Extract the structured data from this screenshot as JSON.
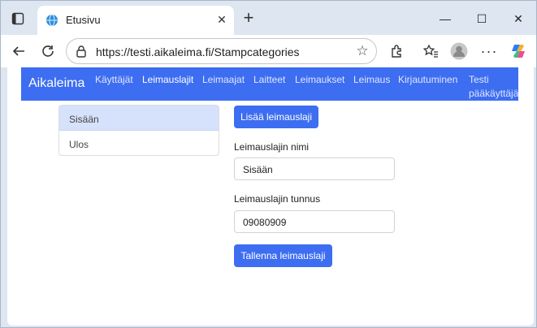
{
  "browser": {
    "tab_title": "Etusivu",
    "tab_close_glyph": "✕",
    "new_tab_glyph": "+",
    "url": "https://testi.aikaleima.fi/Stampcategories",
    "window_controls": {
      "minimize": "—",
      "maximize": "☐",
      "close": "✕"
    },
    "icons": [
      "window-icon",
      "globe-icon",
      "back-arrow-icon",
      "reload-icon",
      "lock-icon",
      "star-icon",
      "extensions-icon",
      "favorites-icon",
      "profile-avatar-icon",
      "more-icon",
      "copilot-icon"
    ]
  },
  "navbar": {
    "brand": "Aikaleima",
    "links": [
      {
        "label": "Käyttäjät"
      },
      {
        "label": "Leimauslajit"
      },
      {
        "label": "Leimaajat"
      },
      {
        "label": "Laitteet"
      },
      {
        "label": "Leimaukset"
      },
      {
        "label": "Leimaus"
      },
      {
        "label": "Kirjautuminen"
      },
      {
        "label_line1": "Testi",
        "label_line2": "pääkäyttäjä"
      }
    ],
    "active": "Leimauslajit"
  },
  "categories": {
    "items": [
      {
        "label": "Sisään"
      },
      {
        "label": "Ulos"
      }
    ],
    "selected": "Sisään"
  },
  "form": {
    "add_button": "Lisää leimauslaji",
    "name_label": "Leimauslajin nimi",
    "name_value": "Sisään",
    "code_label": "Leimauslajin tunnus",
    "code_value": "09080909",
    "save_button": "Tallenna leimauslaji"
  },
  "colors": {
    "brand_blue": "#3d6df1",
    "selected_item": "#d6e2fb"
  }
}
